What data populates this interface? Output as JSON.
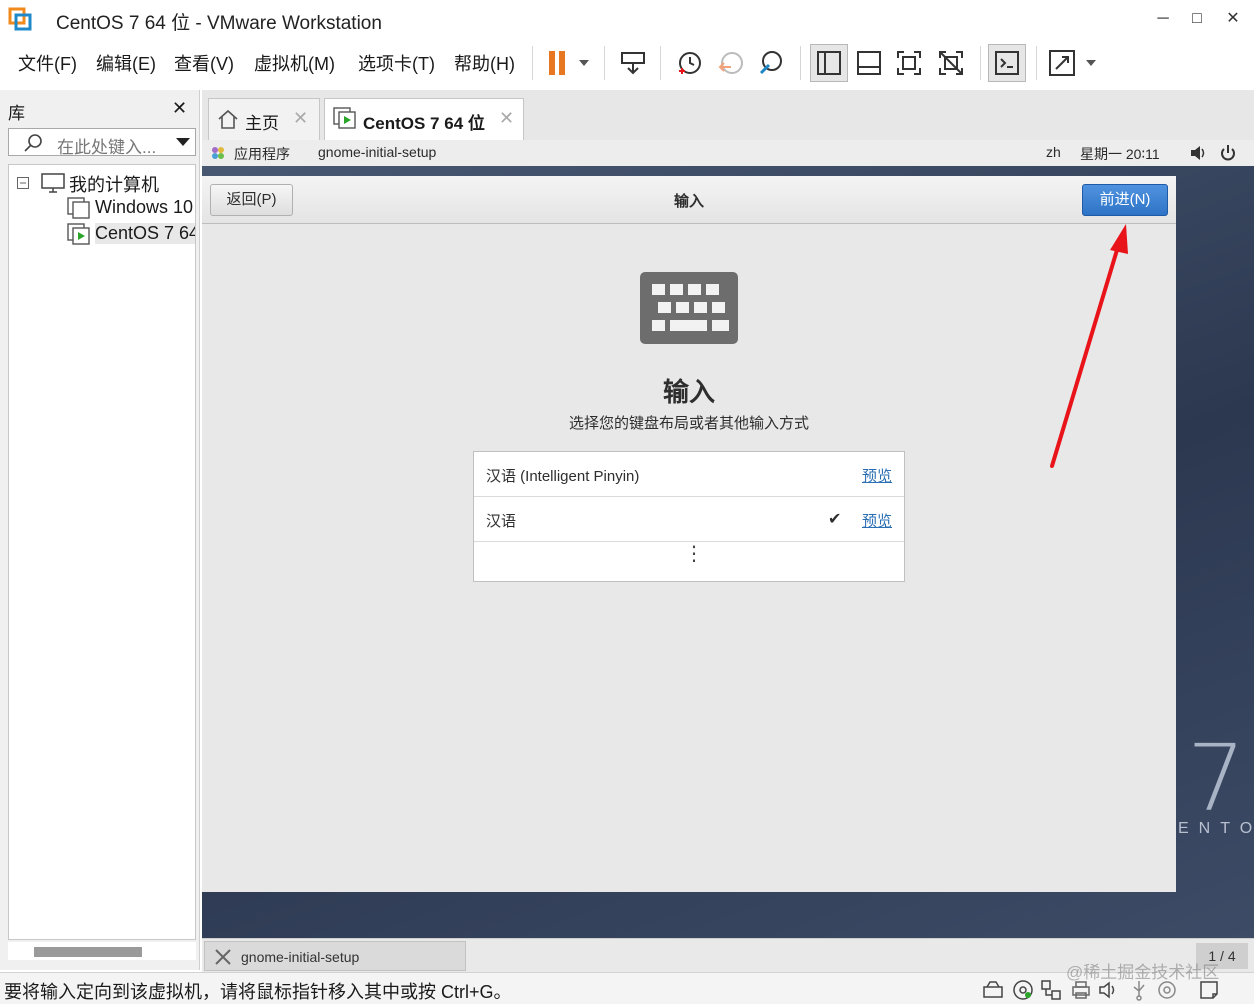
{
  "window": {
    "title": "CentOS 7 64 位 - VMware Workstation",
    "minimize": "─",
    "maximize": "□",
    "close": "✕"
  },
  "menu": {
    "items": [
      "文件(F)",
      "编辑(E)",
      "查看(V)",
      "虚拟机(M)",
      "选项卡(T)",
      "帮助(H)"
    ]
  },
  "toolbar": {
    "icons": [
      "pause-icon",
      "send-ctrl-alt-del-icon",
      "snapshot-icon",
      "revert-snapshot-icon",
      "manage-snapshots-icon",
      "library-view-icon",
      "thumbnail-bar-icon",
      "fullscreen-icon",
      "unity-icon",
      "console-icon",
      "stretch-icon"
    ]
  },
  "library": {
    "title": "库",
    "close": "✕",
    "search_placeholder": "在此处键入...",
    "tree": {
      "root": "我的计算机",
      "items": [
        "Windows 10",
        "CentOS 7 64"
      ]
    }
  },
  "tabs": [
    {
      "label": "主页",
      "close": "✕"
    },
    {
      "label": "CentOS 7 64 位",
      "close": "✕"
    }
  ],
  "gnome_topbar": {
    "apps": "应用程序",
    "current_app": "gnome-initial-setup",
    "lang": "zh",
    "clock": "星期一 20∶11"
  },
  "setup": {
    "back_label": "返回(P)",
    "title": "输入",
    "next_label": "前进(N)",
    "heading": "输入",
    "subtitle": "选择您的键盘布局或者其他输入方式",
    "rows": [
      {
        "label": "汉语 (Intelligent Pinyin)",
        "preview": "预览",
        "selected": false
      },
      {
        "label": "汉语",
        "preview": "预览",
        "selected": true
      }
    ],
    "check_glyph": "✔",
    "more_glyph": "⋮"
  },
  "desktop": {
    "logo_number": "7",
    "logo_text": "ENTO"
  },
  "vm_taskbar": {
    "task_label": "gnome-initial-setup",
    "pager": "1 / 4"
  },
  "statusbar": {
    "text": "要将输入定向到该虚拟机，请将鼠标指针移入其中或按 Ctrl+G。",
    "watermark": "@稀土掘金技术社区"
  },
  "colors": {
    "accent_blue": "#3a82d6",
    "annotation_red": "#e8141a",
    "pause_orange": "#e87722"
  }
}
